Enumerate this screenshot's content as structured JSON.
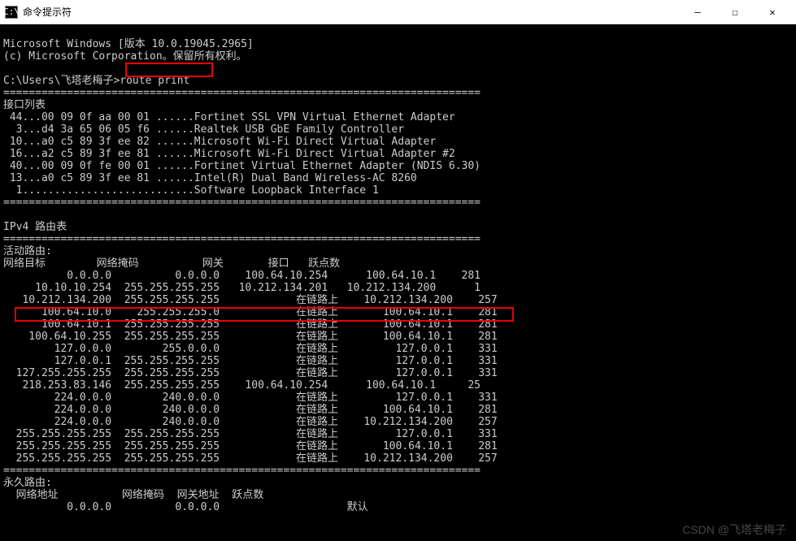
{
  "window": {
    "title": "命令提示符",
    "icon_label": "C:\\",
    "ctrl_min": "—",
    "ctrl_max": "☐",
    "ctrl_close": "✕"
  },
  "header": {
    "line1": "Microsoft Windows [版本 10.0.19045.2965]",
    "line2": "(c) Microsoft Corporation。保留所有权利。"
  },
  "prompt": {
    "path": "C:\\Users\\飞塔老梅子>",
    "command": "route print"
  },
  "sep_full": "===========================================================================",
  "interfaces": {
    "heading": "接口列表",
    "rows": [
      " 44...00 09 0f aa 00 01 ......Fortinet SSL VPN Virtual Ethernet Adapter",
      "  3...d4 3a 65 06 05 f6 ......Realtek USB GbE Family Controller",
      " 10...a0 c5 89 3f ee 82 ......Microsoft Wi-Fi Direct Virtual Adapter",
      " 16...a2 c5 89 3f ee 81 ......Microsoft Wi-Fi Direct Virtual Adapter #2",
      " 40...00 09 0f fe 00 01 ......Fortinet Virtual Ethernet Adapter (NDIS 6.30)",
      " 13...a0 c5 89 3f ee 81 ......Intel(R) Dual Band Wireless-AC 8260",
      "  1...........................Software Loopback Interface 1"
    ]
  },
  "ipv4": {
    "heading": "IPv4 路由表",
    "active_heading": "活动路由:",
    "columns": "网络目标        网络掩码          网关       接口   跃点数",
    "rows": [
      "          0.0.0.0          0.0.0.0    100.64.10.254      100.64.10.1    281",
      "     10.10.10.254  255.255.255.255   10.212.134.201   10.212.134.200      1",
      "   10.212.134.200  255.255.255.255            在链路上    10.212.134.200    257",
      "      100.64.10.0    255.255.255.0            在链路上       100.64.10.1    281",
      "      100.64.10.1  255.255.255.255            在链路上       100.64.10.1    281",
      "    100.64.10.255  255.255.255.255            在链路上       100.64.10.1    281",
      "        127.0.0.0        255.0.0.0            在链路上         127.0.0.1    331",
      "        127.0.0.1  255.255.255.255            在链路上         127.0.0.1    331",
      "  127.255.255.255  255.255.255.255            在链路上         127.0.0.1    331",
      "   218.253.83.146  255.255.255.255    100.64.10.254      100.64.10.1     25",
      "        224.0.0.0        240.0.0.0            在链路上         127.0.0.1    331",
      "        224.0.0.0        240.0.0.0            在链路上       100.64.10.1    281",
      "        224.0.0.0        240.0.0.0            在链路上    10.212.134.200    257",
      "  255.255.255.255  255.255.255.255            在链路上         127.0.0.1    331",
      "  255.255.255.255  255.255.255.255            在链路上       100.64.10.1    281",
      "  255.255.255.255  255.255.255.255            在链路上    10.212.134.200    257"
    ]
  },
  "persistent": {
    "heading": "永久路由:",
    "columns": "  网络地址          网络掩码  网关地址  跃点数",
    "row": "          0.0.0.0          0.0.0.0                    默认"
  },
  "watermark": "CSDN @飞塔老梅子"
}
